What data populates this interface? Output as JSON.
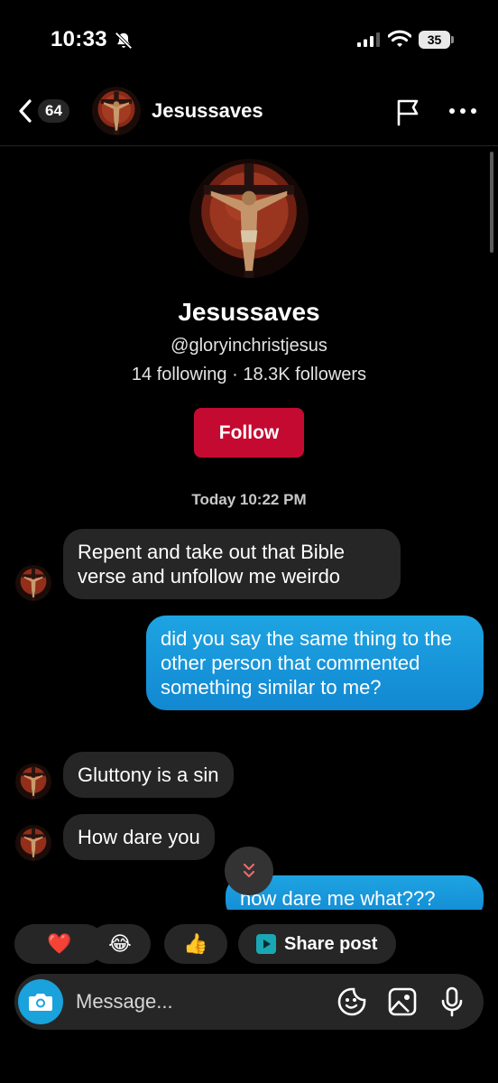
{
  "status_bar": {
    "time": "10:33",
    "battery": "35",
    "icons": [
      "bell-slash-icon",
      "cellular-signal-icon",
      "wifi-icon",
      "battery-icon"
    ]
  },
  "header": {
    "unread_count": "64",
    "username": "Jesussaves",
    "icons": [
      "back-chevron-icon",
      "flag-icon",
      "more-dots-icon"
    ]
  },
  "profile": {
    "display_name": "Jesussaves",
    "handle": "@gloryinchristjesus",
    "stats": "14 following · 18.3K followers",
    "follow_label": "Follow"
  },
  "conversation": {
    "timestamp": "Today 10:22 PM",
    "messages": [
      {
        "from": "them",
        "text": "Repent and take out that Bible verse and unfollow me weirdo"
      },
      {
        "from": "me",
        "text": "did you say the same thing to the other person that commented something similar to me?"
      },
      {
        "from": "them",
        "text": "Gluttony is a sin"
      },
      {
        "from": "them",
        "text": "How dare you"
      },
      {
        "from": "me",
        "text": "how dare me what???"
      }
    ]
  },
  "reactions": {
    "items": [
      "❤️",
      "😂",
      "👍"
    ],
    "share_label": "Share post"
  },
  "composer": {
    "placeholder": "Message..."
  },
  "colors": {
    "accent_blue": "#1a8ed8",
    "follow_red": "#c40a31",
    "bubble_gray": "#262626",
    "background": "#000000"
  }
}
